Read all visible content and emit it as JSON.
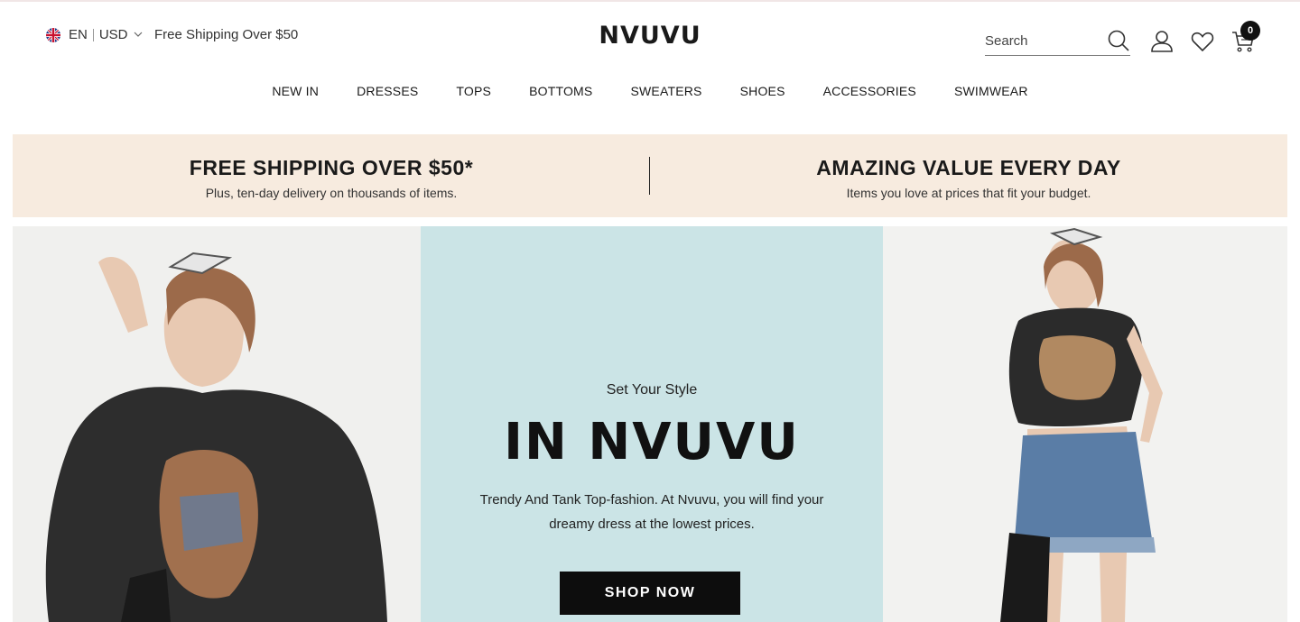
{
  "header": {
    "language": "EN",
    "currency": "USD",
    "free_shipping": "Free Shipping Over $50",
    "logo": "NVUVU",
    "search": {
      "placeholder": "Search"
    },
    "cart_count": "0"
  },
  "nav": {
    "items": [
      "NEW IN",
      "DRESSES",
      "TOPS",
      "BOTTOMS",
      "SWEATERS",
      "SHOES",
      "ACCESSORIES",
      "SWIMWEAR"
    ]
  },
  "promo": {
    "left": {
      "title": "FREE SHIPPING OVER $50*",
      "subtitle": "Plus, ten-day delivery on thousands of items."
    },
    "right": {
      "title": "AMAZING VALUE EVERY DAY",
      "subtitle": "Items you love at prices that fit your budget."
    }
  },
  "hero": {
    "kicker": "Set Your Style",
    "title": "IN NVUVU",
    "description_line1": "Trendy And Tank Top-fashion. At Nvuvu, you will find your",
    "description_line2": "dreamy dress at the lowest prices.",
    "cta": "SHOP NOW"
  },
  "colors": {
    "promo_bg": "#f7ebdf",
    "hero_center_bg": "#cbe4e6",
    "button_bg": "#0d0d0d"
  },
  "icons": [
    "uk-flag-icon",
    "chevron-down-icon",
    "search-icon",
    "user-icon",
    "heart-icon",
    "cart-icon"
  ]
}
